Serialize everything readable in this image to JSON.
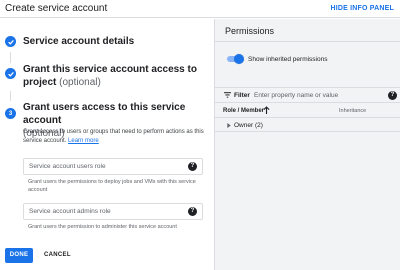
{
  "header": {
    "title": "Create service account",
    "hide_info_panel": "HIDE INFO PANEL"
  },
  "steps": [
    {
      "state": "complete",
      "title": "Service account details",
      "optional": ""
    },
    {
      "state": "complete",
      "title": "Grant this service account access to project",
      "optional": "(optional)"
    },
    {
      "state": "active",
      "number": "3",
      "title": "Grant users access to this service account",
      "optional": "(optional)"
    }
  ],
  "step3": {
    "description": "Grant access to users or groups that need to perform actions as this service account.",
    "learn_more": "Learn more",
    "fields": [
      {
        "label": "Service account users role",
        "hint": "Grant users the permissions to deploy jobs and VMs with this service account"
      },
      {
        "label": "Service account admins role",
        "hint": "Grant users the permission to administer this service account"
      }
    ]
  },
  "actions": {
    "done": "DONE",
    "cancel": "CANCEL"
  },
  "permissions": {
    "title": "Permissions",
    "show_inherited": {
      "label": "Show inherited permissions",
      "on": true
    },
    "filter": {
      "label": "Filter",
      "placeholder": "Enter property name or value"
    },
    "columns": {
      "role_member": "Role / Member",
      "inheritance": "Inheritance"
    },
    "rows": [
      {
        "label": "Owner (2)"
      }
    ]
  },
  "colors": {
    "accent": "#1a73e8",
    "panel_bg": "#f1f3f4"
  }
}
